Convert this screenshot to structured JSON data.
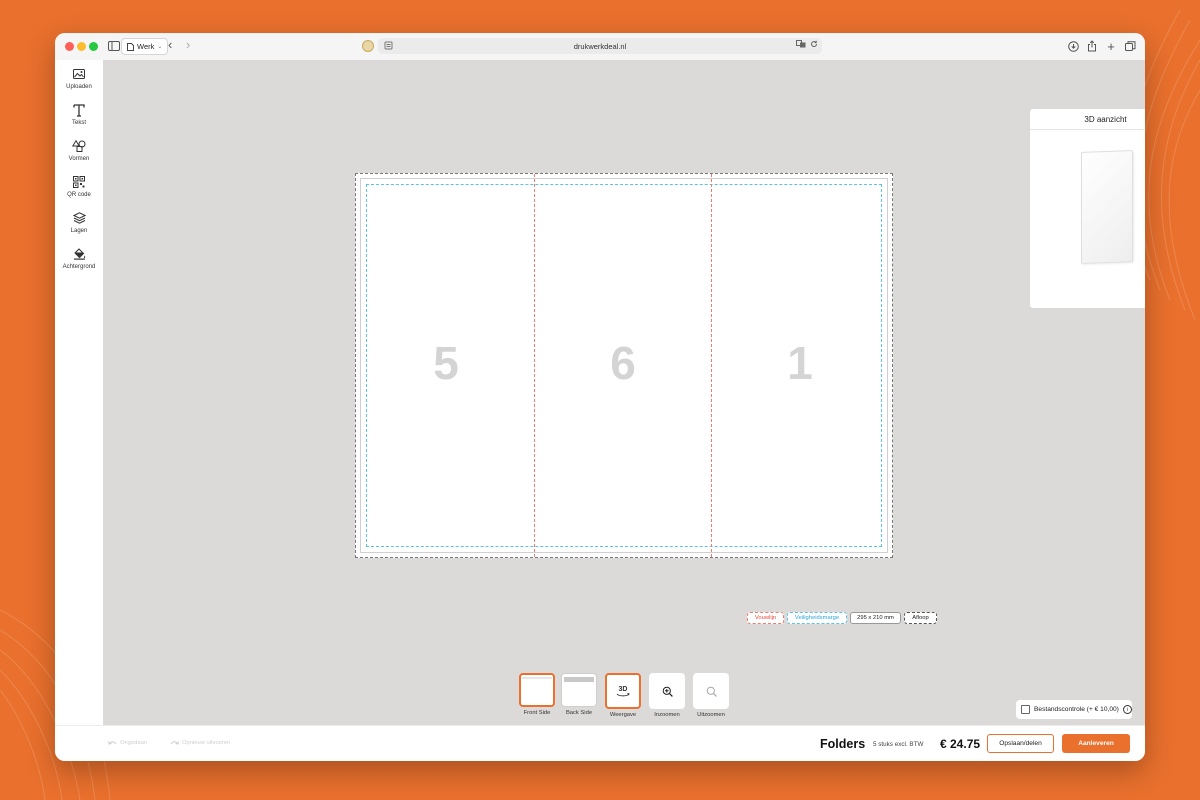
{
  "browser": {
    "tab_group_label": "Werk",
    "address": "drukwerkdeal.nl"
  },
  "tools": [
    {
      "label": "Uploaden",
      "icon": "image-upload-icon"
    },
    {
      "label": "Tekst",
      "icon": "text-icon"
    },
    {
      "label": "Vormen",
      "icon": "shapes-icon"
    },
    {
      "label": "QR code",
      "icon": "qr-code-icon"
    },
    {
      "label": "Lagen",
      "icon": "layers-icon"
    },
    {
      "label": "Achtergrond",
      "icon": "paint-bucket-icon"
    }
  ],
  "canvas": {
    "pages": [
      "5",
      "6",
      "1"
    ]
  },
  "legend": {
    "fold": "Vouwlijn",
    "safety": "Veiligheidsmarge",
    "size": "295 x 210 mm",
    "bleed": "Afloop"
  },
  "preview": {
    "title": "3D aanzicht"
  },
  "controls": {
    "front": "Front Side",
    "back": "Back Side",
    "view": "Weergave",
    "view_icon_text": "3D",
    "zoom_in": "Inzoomen",
    "zoom_out": "Uitzoomen"
  },
  "file_check": {
    "label": "Bestandscontrole (+ € 10,00)",
    "checked": false
  },
  "footer": {
    "undo": "Ongedaan",
    "redo": "Opnieuw uitvoeren",
    "product": "Folders",
    "quantity": "5 stuks excl. BTW",
    "price": "€ 24.75",
    "save": "Opslaan/delen",
    "deliver": "Aanleveren"
  },
  "colors": {
    "accent": "#e9702d",
    "fold_line": "#f07b6d",
    "safety_line": "#5ac3e6",
    "canvas_bg": "#dcdad8"
  }
}
